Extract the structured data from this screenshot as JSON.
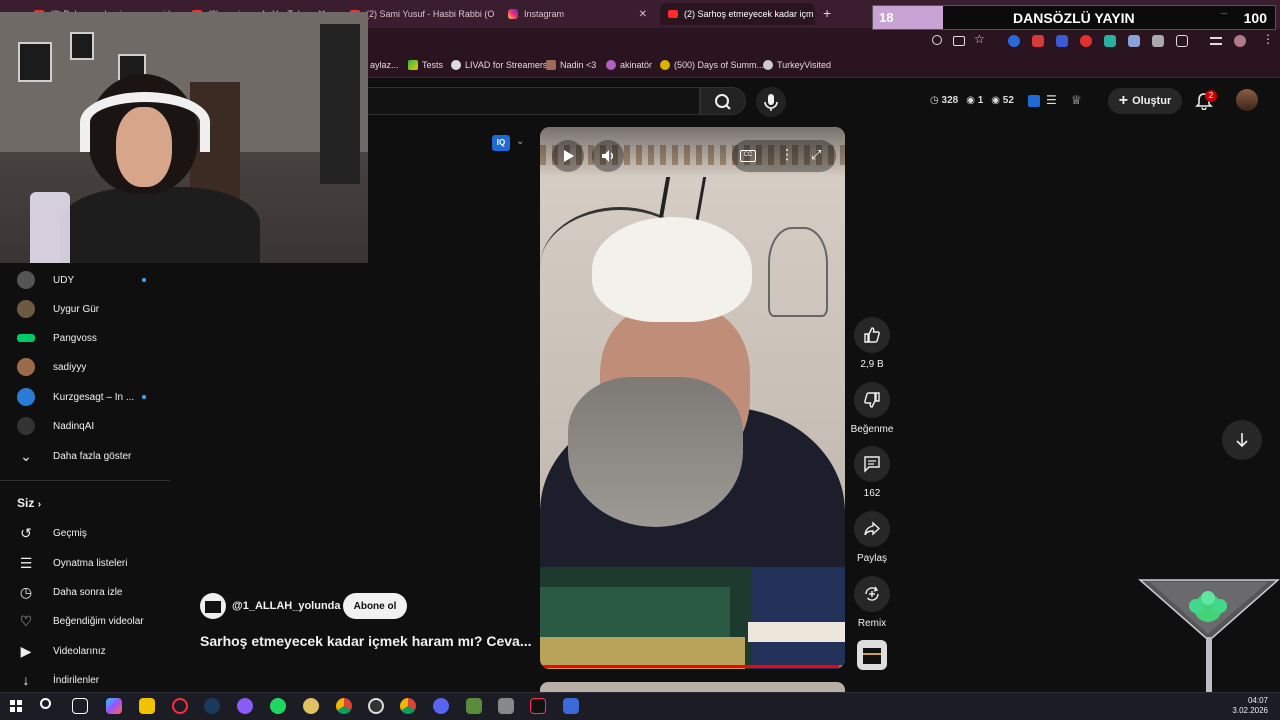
{
  "tabs": [
    {
      "label": "(2) Bahaman hani ve annemi hayi",
      "type": "youtube"
    },
    {
      "label": "(2) sami yusuf - YouTube",
      "type": "youtube"
    },
    {
      "label": "(2) Sami Yusuf - Hasbi Rabbi (O",
      "type": "youtube"
    },
    {
      "label": "Instagram",
      "type": "instagram"
    },
    {
      "label": "(2) Sarhoş etmeyecek kadar içm",
      "type": "youtube",
      "active": true
    }
  ],
  "overlay": {
    "left_number": "18",
    "title": "DANSÖZLÜ YAYIN",
    "right_number": "100"
  },
  "bookmarks": [
    {
      "label": "aylaz..."
    },
    {
      "label": "Tests"
    },
    {
      "label": "LIVAD for Streamers"
    },
    {
      "label": "Nadin <3"
    },
    {
      "label": "akinatör"
    },
    {
      "label": "(500) Days of Summ..."
    },
    {
      "label": "TurkeyVisited"
    }
  ],
  "header": {
    "stats": {
      "clock": "328",
      "eye1": "1",
      "eye2": "52"
    },
    "create_label": "Oluştur",
    "notif_count": "2",
    "iq_label": "IQ"
  },
  "sidebar": {
    "subscriptions": [
      {
        "label": "UDY",
        "live": true,
        "color": "#444"
      },
      {
        "label": "Uygur Gür",
        "live": false,
        "color": "#6b5a40"
      },
      {
        "label": "Pangvoss",
        "live": false,
        "color": "#0c6"
      },
      {
        "label": "sadiyyy",
        "live": false,
        "color": "#9a6b4a"
      },
      {
        "label": "Kurzgesagt – In ...",
        "live": true,
        "color": "#2a7bd6"
      },
      {
        "label": "NadinqAI",
        "live": false,
        "color": "#333"
      }
    ],
    "show_more": "Daha fazla göster",
    "you_heading": "Siz",
    "you_items": [
      {
        "label": "Geçmiş",
        "icon": "history-icon"
      },
      {
        "label": "Oynatma listeleri",
        "icon": "playlists-icon"
      },
      {
        "label": "Daha sonra izle",
        "icon": "watch-later-icon"
      },
      {
        "label": "Beğendiğim videolar",
        "icon": "liked-videos-icon"
      },
      {
        "label": "Videolarınız",
        "icon": "your-videos-icon"
      },
      {
        "label": "İndirilenler",
        "icon": "downloads-icon"
      }
    ]
  },
  "short": {
    "channel": "@1_ALLAH_yolunda",
    "subscribe_label": "Abone ol",
    "title": "Sarhoş etmeyecek kadar içmek haram mı? Ceva...",
    "progress": 0.98,
    "likes": "2,9 B",
    "dislike_label": "Beğenme",
    "comments": "162",
    "share_label": "Paylaş",
    "remix_label": "Remix"
  },
  "taskbar": {
    "time": "04:07",
    "date": "3.02.2026"
  }
}
